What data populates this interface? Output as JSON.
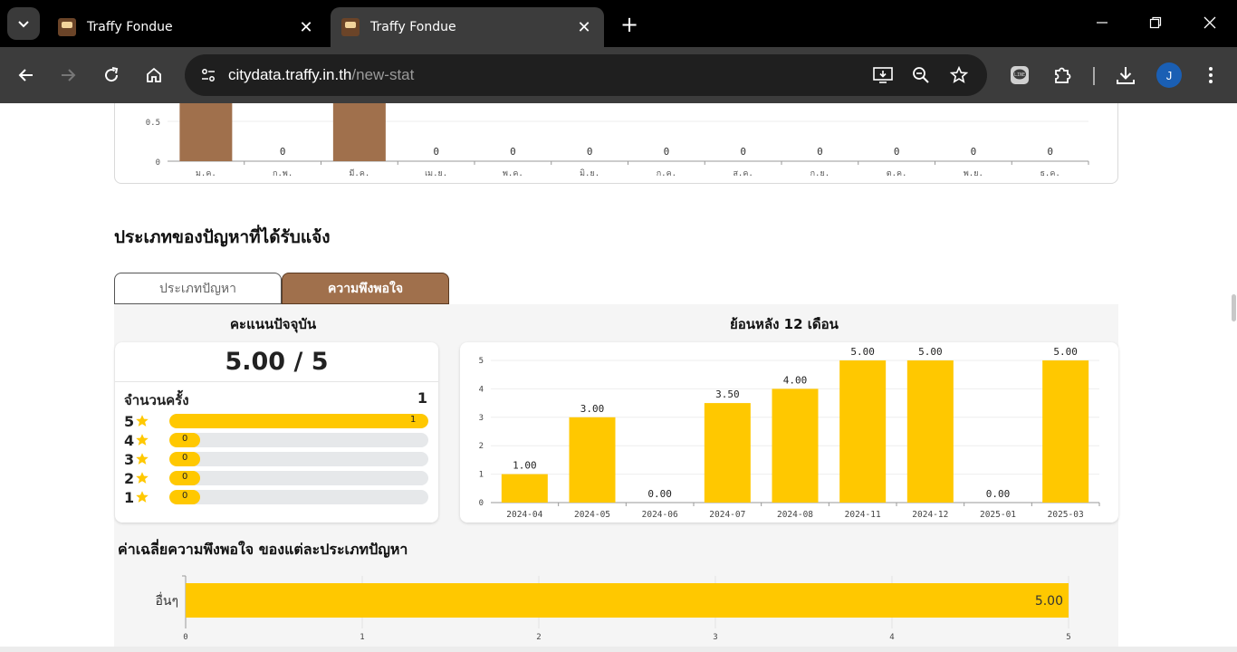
{
  "browser": {
    "tabs": [
      {
        "title": "Traffy Fondue",
        "active": false
      },
      {
        "title": "Traffy Fondue",
        "active": true
      }
    ],
    "url_host": "citydata.traffy.in.th",
    "url_path": "/new-stat",
    "avatar_letter": "J"
  },
  "monthly_chart": {
    "y_ticks": [
      "0.5",
      "0"
    ],
    "months": [
      "ม.ค.",
      "ก.พ.",
      "มี.ค.",
      "เม.ย.",
      "พ.ค.",
      "มิ.ย.",
      "ก.ค.",
      "ส.ค.",
      "ก.ย.",
      "ต.ค.",
      "พ.ย.",
      "ธ.ค."
    ],
    "value_labels": [
      "",
      "0",
      "",
      "0",
      "0",
      "0",
      "0",
      "0",
      "0",
      "0",
      "0",
      "0"
    ],
    "bar_color": "#a0704c"
  },
  "section": {
    "title": "ประเภทของปัญหาที่ได้รับแจ้ง",
    "tab_problem": "ประเภทปัญหา",
    "tab_satisfaction": "ความพึงพอใจ"
  },
  "score": {
    "title": "คะแนนปัจจุบัน",
    "main": "5.00 / 5",
    "count_label": "จำนวนครั้ง",
    "count_value": "1",
    "rows": [
      {
        "star": "5",
        "count": "1",
        "fraction": 1.0
      },
      {
        "star": "4",
        "count": "0",
        "fraction": 0
      },
      {
        "star": "3",
        "count": "0",
        "fraction": 0
      },
      {
        "star": "2",
        "count": "0",
        "fraction": 0
      },
      {
        "star": "1",
        "count": "0",
        "fraction": 0
      }
    ]
  },
  "trend": {
    "title": "ย้อนหลัง 12 เดือน"
  },
  "avg": {
    "title": "ค่าเฉลี่ยความพึงพอใจ ของแต่ละประเภทปัญหา"
  },
  "chart_data": [
    {
      "type": "bar",
      "categories": [
        "2024-04",
        "2024-05",
        "2024-06",
        "2024-07",
        "2024-08",
        "2024-11",
        "2024-12",
        "2025-01",
        "2025-03"
      ],
      "values": [
        1.0,
        3.0,
        0.0,
        3.5,
        4.0,
        5.0,
        5.0,
        0.0,
        5.0
      ],
      "data_labels": [
        "1.00",
        "3.00",
        "0.00",
        "3.50",
        "4.00",
        "5.00",
        "5.00",
        "0.00",
        "5.00"
      ],
      "ylim": [
        0,
        5
      ],
      "y_ticks": [
        "0",
        "1",
        "2",
        "3",
        "4",
        "5"
      ],
      "grid": true,
      "color": "#ffc800"
    },
    {
      "type": "bar",
      "orientation": "horizontal",
      "categories": [
        "อื่นๆ"
      ],
      "values": [
        5.0
      ],
      "data_labels": [
        "5.00"
      ],
      "xlim": [
        0,
        5
      ],
      "x_ticks": [
        "0",
        "1",
        "2",
        "3",
        "4",
        "5"
      ],
      "grid": true,
      "color": "#ffc800"
    }
  ]
}
